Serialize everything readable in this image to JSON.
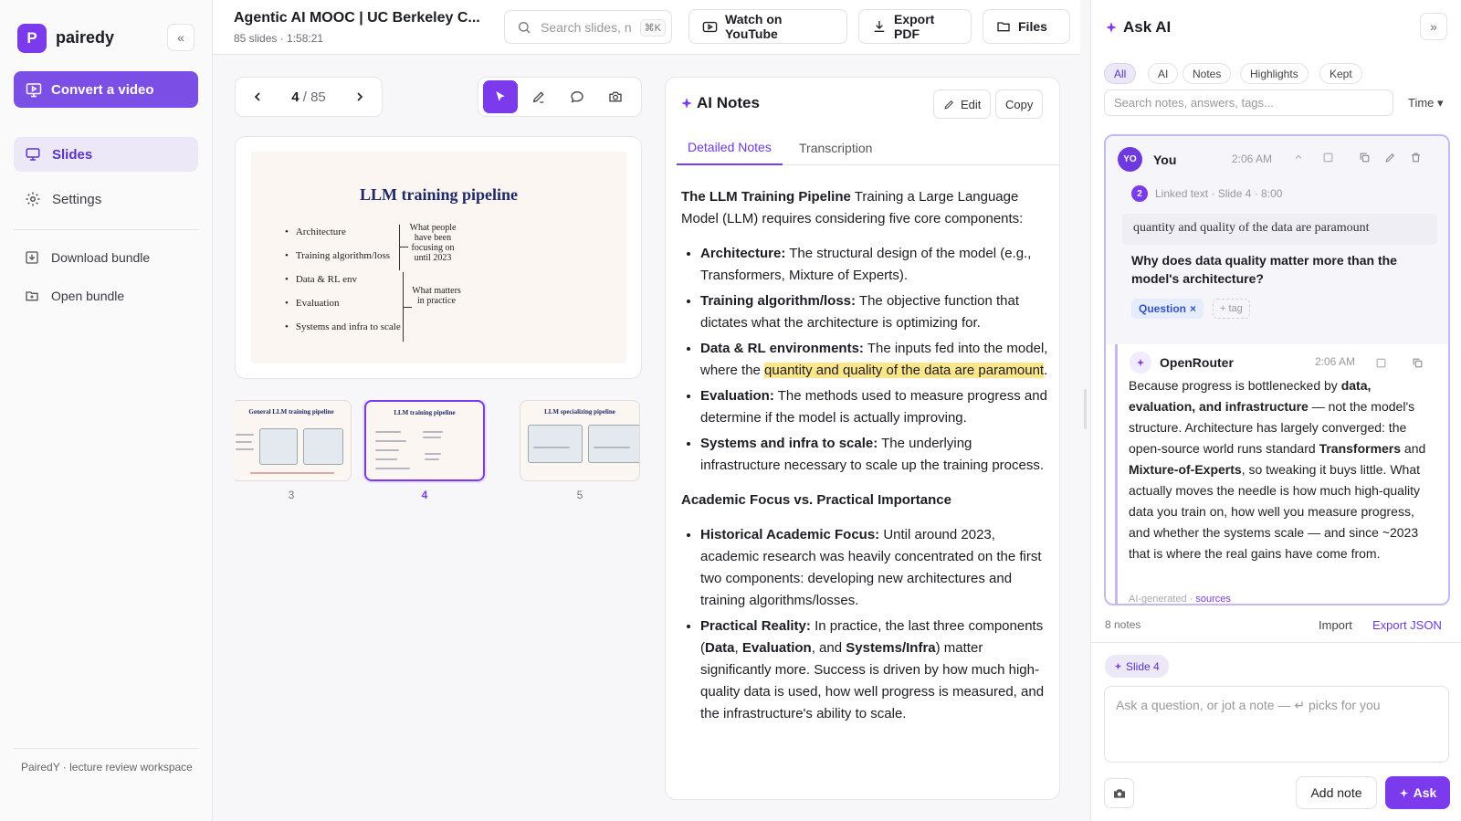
{
  "sidebar": {
    "logo_letter": "P",
    "brand": "pairedy",
    "collapse_glyph": "«",
    "convert_label": "Convert a video",
    "nav": [
      {
        "label": "Slides",
        "icon": "monitor-icon"
      },
      {
        "label": "Settings",
        "icon": "gear-icon"
      }
    ],
    "actions": [
      {
        "label": "Download bundle",
        "icon": "download-icon"
      },
      {
        "label": "Open bundle",
        "icon": "folder-open-icon"
      }
    ],
    "footer": "PairedY · lecture review workspace"
  },
  "header": {
    "title": "Agentic AI MOOC | UC Berkeley C...",
    "meta": "85 slides · 1:58:21",
    "search_placeholder": "Search slides, n",
    "search_kbd": "⌘K",
    "watch_label": "Watch on YouTube",
    "export_label": "Export PDF",
    "files_label": "Files"
  },
  "pager": {
    "current": "4",
    "total": "/ 85"
  },
  "slide": {
    "title": "LLM training pipeline",
    "bullets": [
      "Architecture",
      "Training algorithm/loss",
      "Data & RL env",
      "Evaluation",
      "Systems and infra to scale"
    ],
    "note_top": "What people have been focusing on until 2023",
    "note_bottom": "What matters in practice"
  },
  "thumbnails": [
    {
      "number": "3",
      "title": "General LLM training pipeline"
    },
    {
      "number": "4",
      "title": "LLM training pipeline"
    },
    {
      "number": "5",
      "title": "LLM specializing pipeline"
    }
  ],
  "notes": {
    "title": "AI Notes",
    "edit_label": "Edit",
    "copy_label": "Copy",
    "tabs": [
      "Detailed Notes",
      "Transcription"
    ],
    "intro_bold": "The LLM Training Pipeline",
    "intro_text": " Training a Large Language Model (LLM) requires considering five core components:",
    "items": [
      {
        "bold": "Architecture:",
        "text": " The structural design of the model (e.g., Transformers, Mixture of Experts)."
      },
      {
        "bold": "Training algorithm/loss:",
        "text": " The objective function that dictates what the architecture is optimizing for."
      },
      {
        "bold": "Data & RL environments:",
        "text_before": " The inputs fed into the model, where the ",
        "highlight": "quantity and quality of the data are paramount",
        "text_after": "."
      },
      {
        "bold": "Evaluation:",
        "text": " The methods used to measure progress and determine if the model is actually improving."
      },
      {
        "bold": "Systems and infra to scale:",
        "text": " The underlying infrastructure necessary to scale up the training process."
      }
    ],
    "section2": "Academic Focus vs. Practical Importance",
    "items2": [
      {
        "bold": "Historical Academic Focus:",
        "text": " Until around 2023, academic research was heavily concentrated on the first two components: developing new architectures and training algorithms/losses."
      },
      {
        "bold": "Practical Reality:",
        "text_a": " In practice, the last three components (",
        "b1": "Data",
        "t1": ", ",
        "b2": "Evaluation",
        "t2": ", and ",
        "b3": "Systems/Infra",
        "text_b": ") matter significantly more. Success is driven by how much high-quality data is used, how well progress is measured, and the infrastructure's ability to scale."
      }
    ]
  },
  "ask": {
    "title": "Ask AI",
    "collapse_glyph": "»",
    "filters": [
      "All",
      "AI",
      "Notes",
      "Highlights",
      "Kept"
    ],
    "search_placeholder": "Search notes, answers, tags...",
    "sort_label": "Time ▾",
    "you": {
      "initials": "YO",
      "name": "You",
      "time": "2:06 AM",
      "linked_number": "2",
      "linked_text": "Linked text · Slide 4 · 8:00",
      "quote": "quantity and quality of the data are paramount",
      "question": "Why does data quality matter more than the model's architecture?",
      "tag": "Question",
      "tag_remove": "×",
      "add_tag": "+ tag"
    },
    "ai": {
      "name": "OpenRouter",
      "time": "2:06 AM",
      "a1": "Because progress is bottlenecked by ",
      "b1": "data, evaluation, and infrastructure",
      "a2": " — not the model's structure. Architecture has largely converged: the open-source world runs standard ",
      "b2": "Transformers",
      "a3": " and ",
      "b3": "Mixture-of-Experts",
      "a4": ", so tweaking it buys little. What actually moves the needle is how much high-quality data you train on, how well you measure progress, and whether the systems scale — and since ~2023 that is where the real gains have come from.",
      "footer_text": "AI-generated · ",
      "footer_link": "sources"
    },
    "notes_count": "8 notes",
    "import_label": "Import",
    "export_label": "Export JSON",
    "slide_chip": "Slide 4",
    "compose_placeholder": "Ask a question, or jot a note — ↵ picks for you",
    "add_note_label": "Add note",
    "ask_label": "Ask"
  },
  "colors": {
    "accent": "#7c3aed",
    "accent_soft": "#ece8f8",
    "highlight": "#fde68a",
    "tag_blue": "#3552c8"
  }
}
